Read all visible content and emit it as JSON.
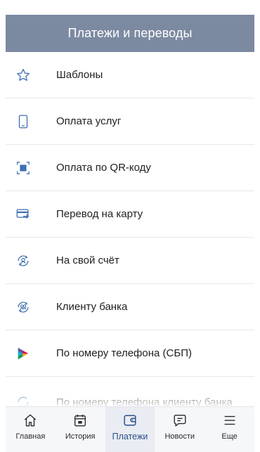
{
  "header": {
    "title": "Платежи и переводы"
  },
  "menu": {
    "items": [
      {
        "label": "Шаблоны",
        "icon": "star-icon"
      },
      {
        "label": "Оплата услуг",
        "icon": "phone-icon"
      },
      {
        "label": "Оплата по QR-коду",
        "icon": "qr-scan-icon"
      },
      {
        "label": "Перевод на карту",
        "icon": "card-transfer-icon"
      },
      {
        "label": "На свой счёт",
        "icon": "own-account-icon"
      },
      {
        "label": "Клиенту банка",
        "icon": "bank-client-icon"
      },
      {
        "label": "По номеру телефона (СБП)",
        "icon": "sbp-icon"
      },
      {
        "label": "По номеру телефона клиенту банка",
        "icon": "phone-client-icon"
      }
    ]
  },
  "tabbar": {
    "tabs": [
      {
        "label": "Главная",
        "icon": "home-icon"
      },
      {
        "label": "История",
        "icon": "calendar-icon"
      },
      {
        "label": "Платежи",
        "icon": "wallet-icon",
        "active": true
      },
      {
        "label": "Новости",
        "icon": "chat-icon"
      },
      {
        "label": "Еще",
        "icon": "menu-icon"
      }
    ]
  },
  "colors": {
    "header_bg": "#7c8aa1",
    "accent": "#2a4f8c",
    "icon_blue": "#3d6fb0",
    "divider": "#e6e8ec",
    "tabbar_bg": "#f6f7f9"
  }
}
